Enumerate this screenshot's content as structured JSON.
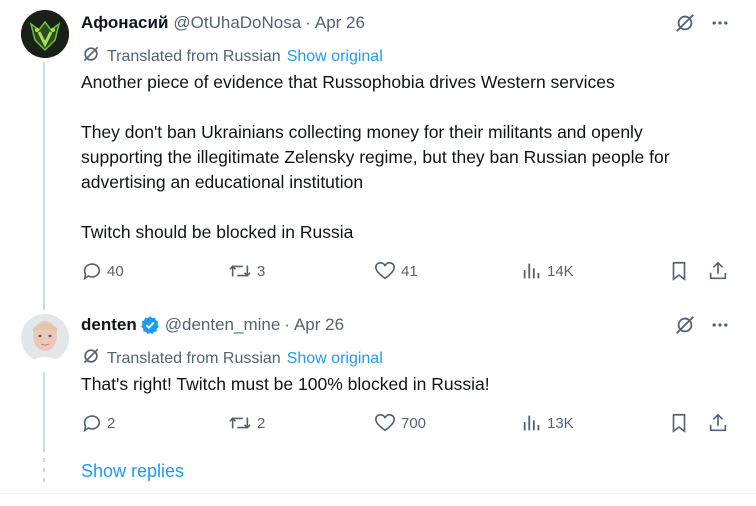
{
  "tweets": [
    {
      "name": "Афонасий",
      "handle": "@OtUhaDoNosa",
      "separator": "·",
      "date": "Apr 26",
      "translated_label": "Translated from Russian",
      "show_original": "Show original",
      "paragraphs": [
        "Another piece of evidence that Russophobia drives Western services",
        "They don't ban Ukrainians collecting money for their militants and openly supporting the illegitimate Zelensky regime, but they ban Russian people for advertising an educational institution",
        "Twitch should be blocked in Russia"
      ],
      "replies": "40",
      "reposts": "3",
      "likes": "41",
      "views": "14K",
      "verified": false,
      "avatar_colors": {
        "bg": "#1b1f1a",
        "fg": "#6fbf3c"
      }
    },
    {
      "name": "denten",
      "handle": "@denten_mine",
      "separator": "·",
      "date": "Apr 26",
      "translated_label": "Translated from Russian",
      "show_original": "Show original",
      "paragraphs": [
        "That's right! Twitch must be 100% blocked in Russia!"
      ],
      "replies": "2",
      "reposts": "2",
      "likes": "700",
      "views": "13K",
      "verified": true,
      "avatar_colors": {
        "bg": "#d9dde0",
        "fg": "#e8c3b4"
      }
    }
  ],
  "show_replies": "Show replies",
  "colors": {
    "text": "#0f1419",
    "secondary": "#536471",
    "accent": "#1d9bf0",
    "line": "#cfd9de"
  },
  "icons": [
    "grok-icon",
    "more-icon",
    "translate-icon",
    "reply-icon",
    "repost-icon",
    "like-icon",
    "views-icon",
    "bookmark-icon",
    "share-icon",
    "verified-badge-icon"
  ]
}
